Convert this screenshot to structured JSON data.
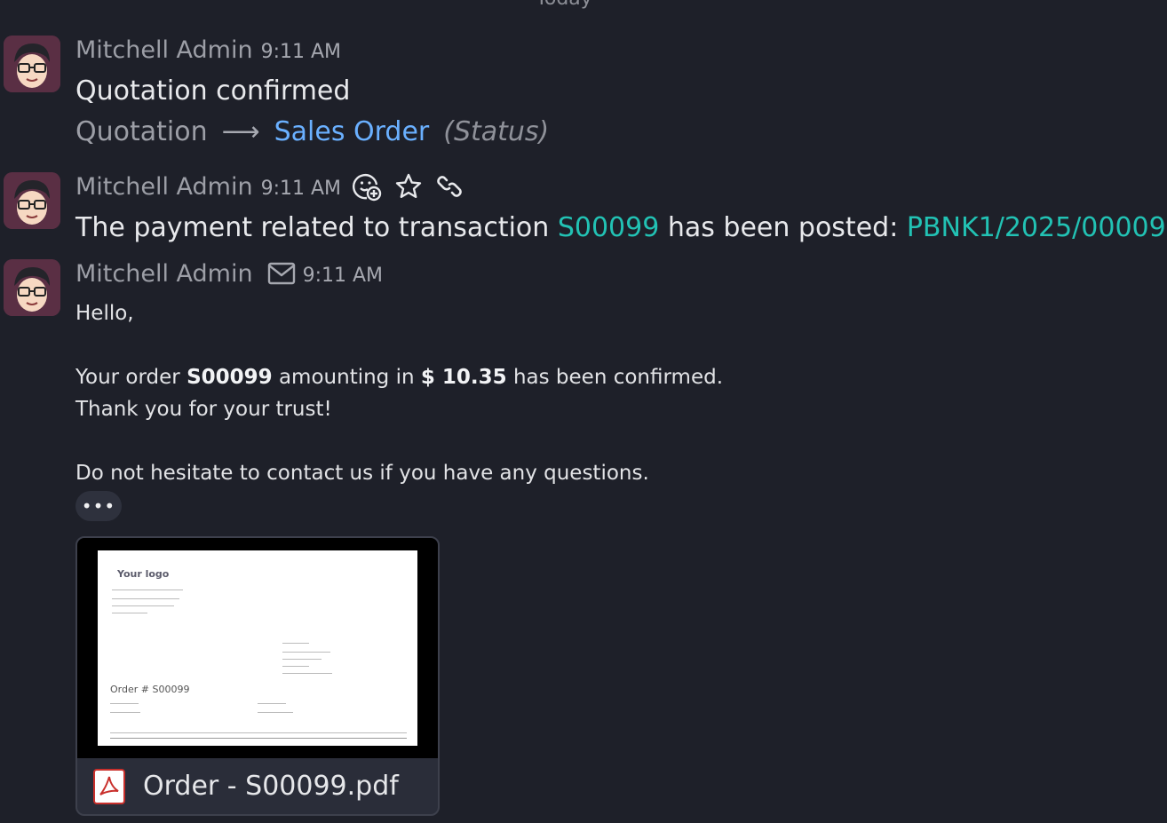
{
  "day_separator": "Today",
  "messages": [
    {
      "author": "Mitchell Admin",
      "time": "9:11 AM",
      "text": "Quotation confirmed",
      "tracking": {
        "old": "Quotation",
        "arrow": "⟶",
        "new": "Sales Order",
        "field": "(Status)"
      }
    },
    {
      "author": "Mitchell Admin",
      "time": "9:11 AM",
      "icons": [
        "add-reaction-icon",
        "star-icon",
        "link-icon"
      ],
      "text_before": "The payment related to transaction ",
      "link1": "S00099",
      "text_mid": " has been posted: ",
      "link2": "PBNK1/2025/00009"
    },
    {
      "author": "Mitchell Admin",
      "time": "9:11 AM",
      "icon": "envelope-icon",
      "greeting": "Hello,",
      "line_a1": "Your order ",
      "order": "S00099",
      "line_a2": " amounting in ",
      "amount": "$ 10.35",
      "line_a3": " has been confirmed.",
      "line_b": "Thank you for your trust!",
      "line_c": "Do not hesitate to contact us if you have any questions.",
      "more_label": "•••",
      "attachment": {
        "filename": "Order - S00099.pdf",
        "preview_logo": "Your logo",
        "preview_order": "Order # S00099"
      }
    }
  ],
  "colors": {
    "background": "#1e2029",
    "link": "#22c2b4",
    "tracking_new": "#6ab0ff"
  }
}
